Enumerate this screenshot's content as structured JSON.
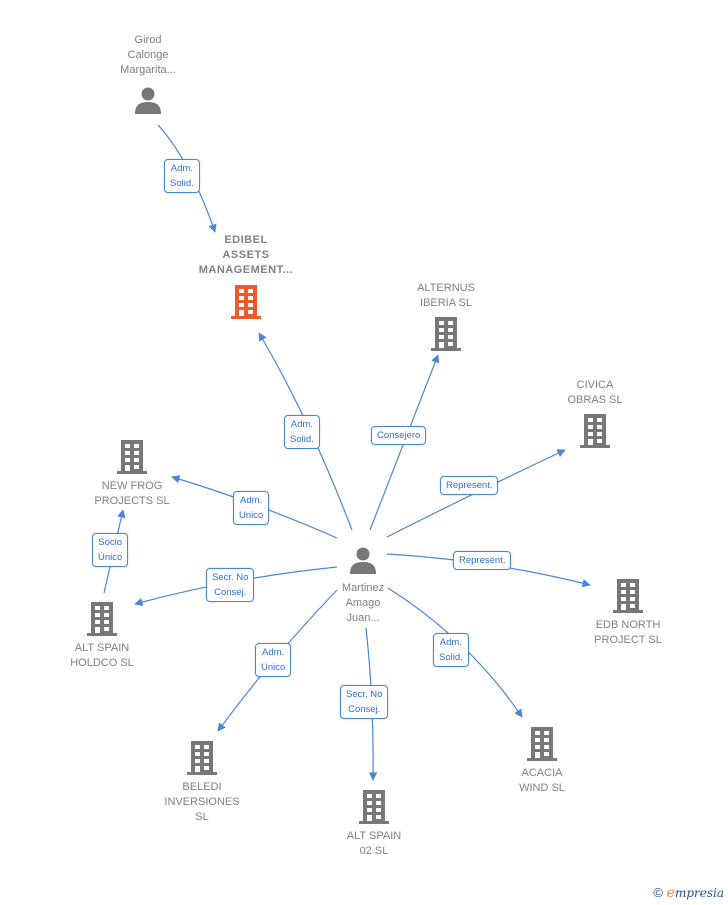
{
  "nodes": {
    "girod": {
      "label": "Girod\nCalonge\nMargarita...",
      "type": "person"
    },
    "edibel": {
      "label": "EDIBEL\nASSETS\nMANAGEMENT...",
      "type": "company",
      "highlight": true,
      "color": "#f05a28"
    },
    "alternus": {
      "label": "ALTERNUS\nIBERIA  SL",
      "type": "company"
    },
    "civica": {
      "label": "CIVICA\nOBRAS SL",
      "type": "company"
    },
    "newfrog": {
      "label": "NEW FROG\nPROJECTS  SL",
      "type": "company"
    },
    "martinez": {
      "label": "Martinez\nAmago\nJuan...",
      "type": "person"
    },
    "edbnorth": {
      "label": "EDB NORTH\nPROJECT  SL",
      "type": "company"
    },
    "altholdco": {
      "label": "ALT SPAIN\nHOLDCO  SL",
      "type": "company"
    },
    "beledi": {
      "label": "BELEDI\nINVERSIONES\nSL",
      "type": "company"
    },
    "altspain02": {
      "label": "ALT SPAIN\n02  SL",
      "type": "company"
    },
    "acacia": {
      "label": "ACACIA\nWIND SL",
      "type": "company"
    }
  },
  "relations": [
    {
      "from": "girod",
      "to": "edibel",
      "label": "Adm.\nSolid."
    },
    {
      "from": "martinez",
      "to": "edibel",
      "label": "Adm.\nSolid."
    },
    {
      "from": "martinez",
      "to": "alternus",
      "label": "Consejero"
    },
    {
      "from": "martinez",
      "to": "civica",
      "label": "Represent."
    },
    {
      "from": "martinez",
      "to": "newfrog",
      "label": "Adm.\nUnico"
    },
    {
      "from": "martinez",
      "to": "edbnorth",
      "label": "Represent."
    },
    {
      "from": "martinez",
      "to": "altholdco",
      "label": "Secr.  No\nConsej."
    },
    {
      "from": "altholdco",
      "to": "newfrog",
      "label": "Socio\nÚnico"
    },
    {
      "from": "martinez",
      "to": "beledi",
      "label": "Adm.\nUnico"
    },
    {
      "from": "martinez",
      "to": "altspain02",
      "label": "Secr.  No\nConsej."
    },
    {
      "from": "martinez",
      "to": "acacia",
      "label": "Adm.\nSolid."
    }
  ],
  "colors": {
    "edge": "#4a86d8",
    "icon": "#777777",
    "highlight": "#f05a28"
  },
  "footer": {
    "copyright": "©",
    "brand_initial": "e",
    "brand_rest": "mpresia"
  }
}
